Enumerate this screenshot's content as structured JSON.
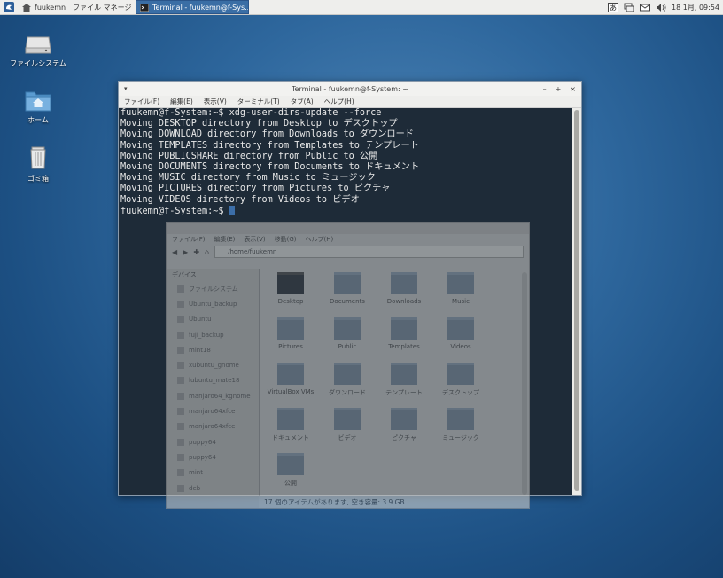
{
  "panel": {
    "tasks": [
      {
        "label": "fuukemn　ファイル マネージ..."
      },
      {
        "label": "Terminal - fuukemn@f-Sys..."
      }
    ],
    "clock": "18 1月, 09:54",
    "icons": [
      "app-menu-icon",
      "keyboard-icon",
      "network-icon",
      "mail-icon",
      "volume-icon"
    ]
  },
  "desktop": {
    "icons": [
      {
        "label": "ファイルシステム",
        "icon": "drive-icon"
      },
      {
        "label": "ホーム",
        "icon": "home-folder-icon"
      },
      {
        "label": "ゴミ箱",
        "icon": "trash-icon"
      }
    ]
  },
  "terminal": {
    "title": "Terminal - fuukemn@f-System: ~",
    "window_menu_glyph": "▾",
    "controls": [
      "–",
      "+",
      "×"
    ],
    "menu": [
      "ファイル(F)",
      "編集(E)",
      "表示(V)",
      "ターミナル(T)",
      "タブ(A)",
      "ヘルプ(H)"
    ],
    "lines": [
      "fuukemn@f-System:~$ xdg-user-dirs-update --force",
      "Moving DESKTOP directory from Desktop to デスクトップ",
      "Moving DOWNLOAD directory from Downloads to ダウンロード",
      "Moving TEMPLATES directory from Templates to テンプレート",
      "Moving PUBLICSHARE directory from Public to 公開",
      "Moving DOCUMENTS directory from Documents to ドキュメント",
      "Moving MUSIC directory from Music to ミュージック",
      "Moving PICTURES directory from Pictures to ピクチャ",
      "Moving VIDEOS directory from Videos to ビデオ"
    ],
    "prompt": "fuukemn@f-System:~$ "
  },
  "filemanager": {
    "menu": [
      "ファイル(F)",
      "編集(E)",
      "表示(V)",
      "移動(G)",
      "ヘルプ(H)"
    ],
    "path": "/home/fuukemn",
    "sidebar_header": "デバイス",
    "sidebar": [
      "ファイルシステム",
      "Ubuntu_backup",
      "Ubuntu",
      "fuji_backup",
      "mint18",
      "xubuntu_gnome",
      "lubuntu_mate18",
      "manjaro64_kgnome",
      "manjaro64xfce",
      "manjaro64xfce",
      "puppy64",
      "puppy64",
      "mint",
      "deb"
    ],
    "items": [
      "Desktop",
      "Documents",
      "Downloads",
      "Music",
      "Pictures",
      "Public",
      "Templates",
      "Videos",
      "VirtualBox VMs",
      "ダウンロード",
      "テンプレート",
      "デスクトップ",
      "ドキュメント",
      "ビデオ",
      "ピクチャ",
      "ミュージック",
      "公開"
    ],
    "status": "17 個のアイテムがあります, 空き容量: 3.9 GB"
  }
}
